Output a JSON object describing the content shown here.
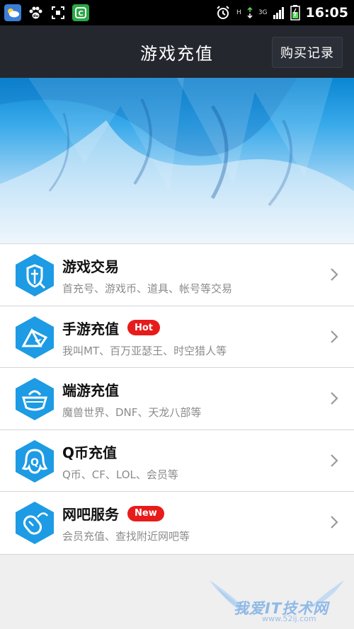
{
  "status_bar": {
    "time": "16:05",
    "signal_labels": [
      "H",
      "3G"
    ],
    "icons": [
      "weather-icon",
      "baidu-paw-icon",
      "screenshot-icon",
      "green-app-icon",
      "alarm-icon",
      "data-arrows-icon",
      "signal-icon",
      "battery-icon"
    ]
  },
  "header": {
    "title": "游戏充值",
    "record_button": "购买记录"
  },
  "menu": [
    {
      "title": "游戏交易",
      "subtitle": "首充号、游戏币、道具、帐号等交易",
      "badge": "",
      "icon": "shield-sword-icon"
    },
    {
      "title": "手游充值",
      "subtitle": "我叫MT、百万亚瑟王、时空猎人等",
      "badge": "Hot",
      "icon": "envelope-icon"
    },
    {
      "title": "端游充值",
      "subtitle": "魔兽世界、DNF、天龙八部等",
      "badge": "",
      "icon": "gold-ingot-icon"
    },
    {
      "title": "Q币充值",
      "subtitle": "Q币、CF、LOL、会员等",
      "badge": "",
      "icon": "qq-penguin-icon"
    },
    {
      "title": "网吧服务",
      "subtitle": "会员充值、查找附近网吧等",
      "badge": "New",
      "icon": "mouse-icon"
    }
  ],
  "colors": {
    "header_bg": "#24272e",
    "icon_blue": "#1d9be4",
    "badge_red": "#e81b1b"
  },
  "watermark": {
    "text": "我爱IT技术网",
    "url": "www.52ij.com"
  }
}
